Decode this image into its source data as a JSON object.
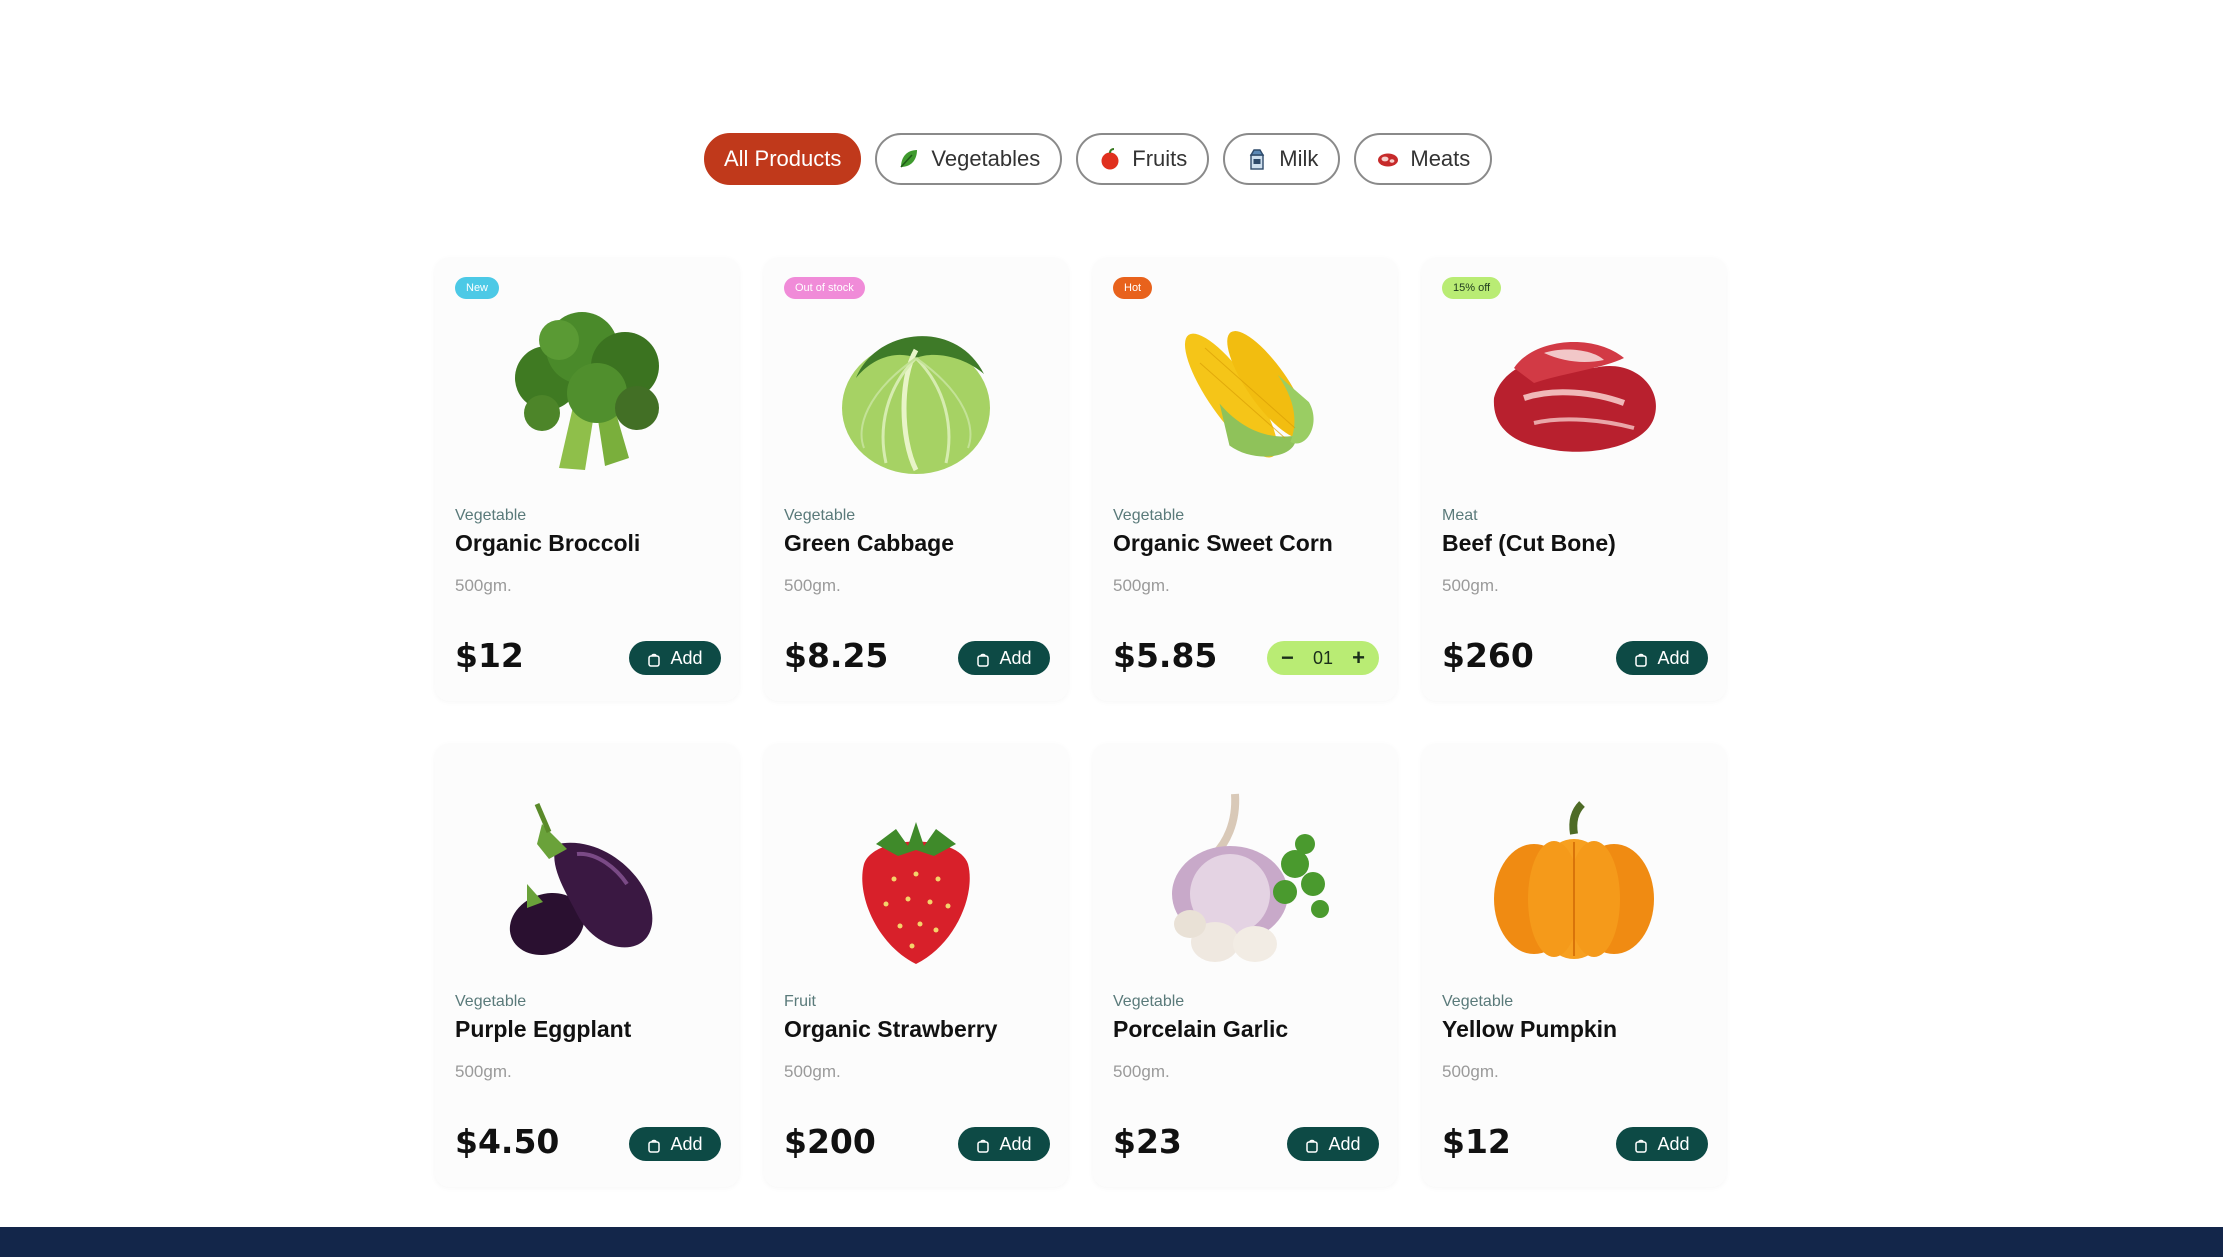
{
  "filters": [
    {
      "label": "All Products",
      "icon": "",
      "active": true
    },
    {
      "label": "Vegetables",
      "icon": "leaf-icon",
      "active": false
    },
    {
      "label": "Fruits",
      "icon": "apple-icon",
      "active": false
    },
    {
      "label": "Milk",
      "icon": "milk-carton-icon",
      "active": false
    },
    {
      "label": "Meats",
      "icon": "meat-icon",
      "active": false
    }
  ],
  "products": [
    {
      "badge": "New",
      "badge_color": "#4cc9e6",
      "category": "Vegetable",
      "name": "Organic Broccoli",
      "weight": "500gm.",
      "price": "$12",
      "action": "add",
      "add_label": "Add",
      "image": "broccoli"
    },
    {
      "badge": "Out of stock",
      "badge_color": "#f08bd8",
      "category": "Vegetable",
      "name": "Green Cabbage",
      "weight": "500gm.",
      "price": "$8.25",
      "action": "add",
      "add_label": "Add",
      "image": "cabbage"
    },
    {
      "badge": "Hot",
      "badge_color": "#e8621c",
      "category": "Vegetable",
      "name": "Organic Sweet Corn",
      "weight": "500gm.",
      "price": "$5.85",
      "action": "stepper",
      "quantity": "01",
      "minus_label": "−",
      "plus_label": "+",
      "image": "corn"
    },
    {
      "badge": "15% off",
      "badge_color": "#b9ec74",
      "badge_text_color": "#1e3a1e",
      "category": "Meat",
      "name": "Beef (Cut Bone)",
      "weight": "500gm.",
      "price": "$260",
      "action": "add",
      "add_label": "Add",
      "image": "beef"
    },
    {
      "badge": "",
      "category": "Vegetable",
      "name": "Purple Eggplant",
      "weight": "500gm.",
      "price": "$4.50",
      "action": "add",
      "add_label": "Add",
      "image": "eggplant"
    },
    {
      "badge": "",
      "category": "Fruit",
      "name": "Organic Strawberry",
      "weight": "500gm.",
      "price": "$200",
      "action": "add",
      "add_label": "Add",
      "image": "strawberry"
    },
    {
      "badge": "",
      "category": "Vegetable",
      "name": "Porcelain Garlic",
      "weight": "500gm.",
      "price": "$23",
      "action": "add",
      "add_label": "Add",
      "image": "garlic"
    },
    {
      "badge": "",
      "category": "Vegetable",
      "name": "Yellow Pumpkin",
      "weight": "500gm.",
      "price": "$12",
      "action": "add",
      "add_label": "Add",
      "image": "pumpkin"
    }
  ],
  "colors": {
    "accent": "#c0391b",
    "add_button": "#0d4a45",
    "stepper": "#b9ec74",
    "footer": "#13264a"
  }
}
